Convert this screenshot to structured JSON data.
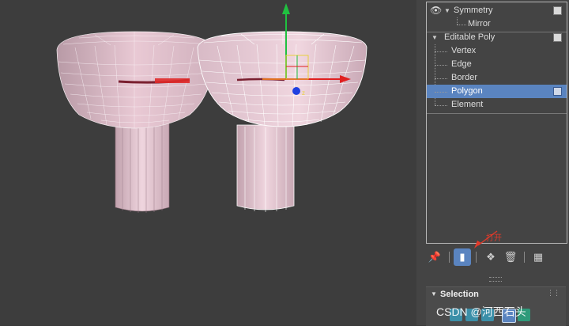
{
  "modifier_stack": {
    "items": [
      {
        "label": "Symmetry",
        "level": 0,
        "expanded": true,
        "has_eye": true
      },
      {
        "label": "Mirror",
        "level": 1
      },
      {
        "label": "Editable Poly",
        "level": 0,
        "expanded": true
      },
      {
        "label": "Vertex",
        "level": 1
      },
      {
        "label": "Edge",
        "level": 1
      },
      {
        "label": "Border",
        "level": 1
      },
      {
        "label": "Polygon",
        "level": 1,
        "selected": true
      },
      {
        "label": "Element",
        "level": 1
      }
    ]
  },
  "toolbar": {
    "icons": [
      "pin-stack-icon",
      "show-end-result-icon",
      "make-unique-icon",
      "remove-modifier-icon",
      "configure-modifier-sets-icon"
    ],
    "active": "show-end-result-icon"
  },
  "annotation": {
    "text": "打开",
    "color": "#e03a2a"
  },
  "selection_rollout": {
    "title": "Selection"
  },
  "watermark": {
    "text": "CSDN @河西石头"
  },
  "colors": {
    "selected_row": "#5a84c0",
    "model_fill": "#e8c8d2",
    "gizmo_x": "#e02020",
    "gizmo_y": "#20c040",
    "gizmo_z": "#2040e0"
  }
}
